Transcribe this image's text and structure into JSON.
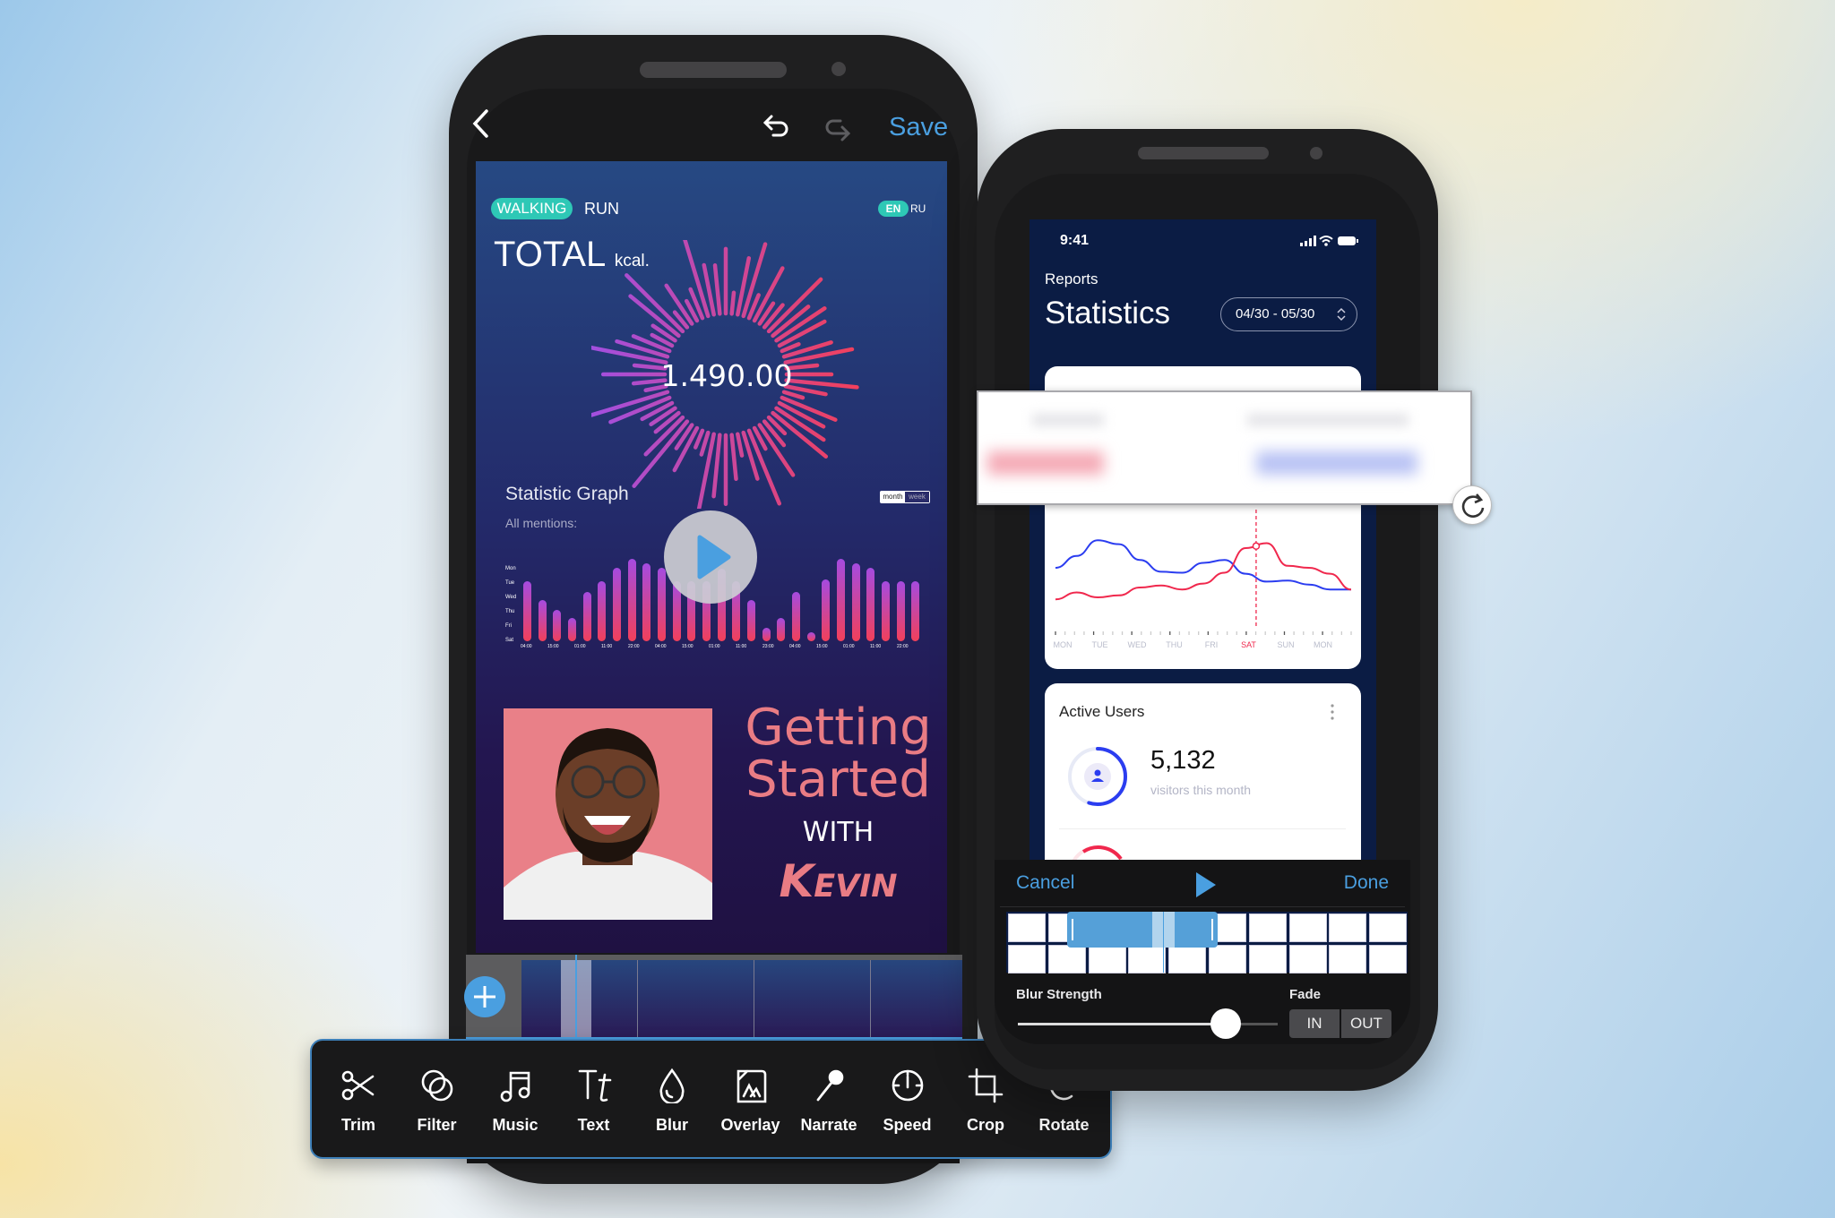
{
  "editor": {
    "save_label": "Save",
    "back_icon": "chevron-left-icon",
    "undo_icon": "undo-icon",
    "redo_icon": "redo-icon",
    "accent": "#4a9fe0"
  },
  "preview": {
    "tabs": [
      "WALKING",
      "RUN"
    ],
    "active_tab": "WALKING",
    "langs": [
      "EN",
      "RU"
    ],
    "active_lang": "EN",
    "total_label": "TOTAL",
    "total_unit": "kcal.",
    "total_value": "1.490.00",
    "graph_title": "Statistic Graph",
    "graph_subtitle": "All mentions:",
    "toggle": [
      "month",
      "week"
    ],
    "y_labels": [
      "Mon",
      "Tue",
      "Wed",
      "Thu",
      "Fri",
      "Sat"
    ],
    "x_labels": [
      "04:00",
      "15:00",
      "01:00",
      "11:00",
      "22:00",
      "04:00",
      "15:00",
      "01:00",
      "11:00",
      "23:00",
      "04:00",
      "15:00",
      "01:00",
      "11:00",
      "22:00"
    ],
    "bar_values": [
      63,
      43,
      33,
      24,
      52,
      63,
      77,
      86,
      82,
      77,
      63,
      63,
      63,
      76,
      63,
      43,
      14,
      24,
      52,
      9,
      65,
      86,
      82,
      77,
      63,
      63,
      63
    ],
    "title_line1": "Getting",
    "title_line2": "Started",
    "title_with": "WITH",
    "title_name": "Kevin",
    "accent_pink": "#e97c84",
    "teal": "#2ec8b6"
  },
  "toolbar": {
    "items": [
      {
        "label": "Trim",
        "icon": "scissors-icon"
      },
      {
        "label": "Filter",
        "icon": "filter-icon"
      },
      {
        "label": "Music",
        "icon": "music-icon"
      },
      {
        "label": "Text",
        "icon": "text-icon"
      },
      {
        "label": "Blur",
        "icon": "droplet-icon"
      },
      {
        "label": "Overlay",
        "icon": "overlay-icon"
      },
      {
        "label": "Narrate",
        "icon": "microphone-icon"
      },
      {
        "label": "Speed",
        "icon": "speedometer-icon"
      },
      {
        "label": "Crop",
        "icon": "crop-icon"
      },
      {
        "label": "Rotate",
        "icon": "rotate-icon"
      }
    ]
  },
  "stats": {
    "time": "9:41",
    "subtitle": "Reports",
    "title": "Statistics",
    "date_range": "04/30 - 05/30",
    "chart": {
      "days": [
        "MON",
        "TUE",
        "WED",
        "THU",
        "FRI",
        "SAT",
        "SUN",
        "MON"
      ],
      "highlight": "SAT",
      "blue": [
        50,
        62,
        78,
        74,
        58,
        46,
        45,
        55,
        58,
        44,
        36,
        37,
        33,
        28,
        28
      ],
      "red": [
        18,
        25,
        20,
        22,
        30,
        32,
        28,
        34,
        45,
        70,
        75,
        52,
        50,
        44,
        28
      ],
      "blue_color": "#2b3df0",
      "red_color": "#f0284d"
    },
    "active_users": {
      "title": "Active Users",
      "value": "5,132",
      "caption": "visitors this month",
      "progress": 0.55
    }
  },
  "blur_editor": {
    "cancel": "Cancel",
    "done": "Done",
    "blur_label": "Blur Strength",
    "blur_value": 0.8,
    "fade_label": "Fade",
    "fade_in": "IN",
    "fade_out": "OUT"
  }
}
